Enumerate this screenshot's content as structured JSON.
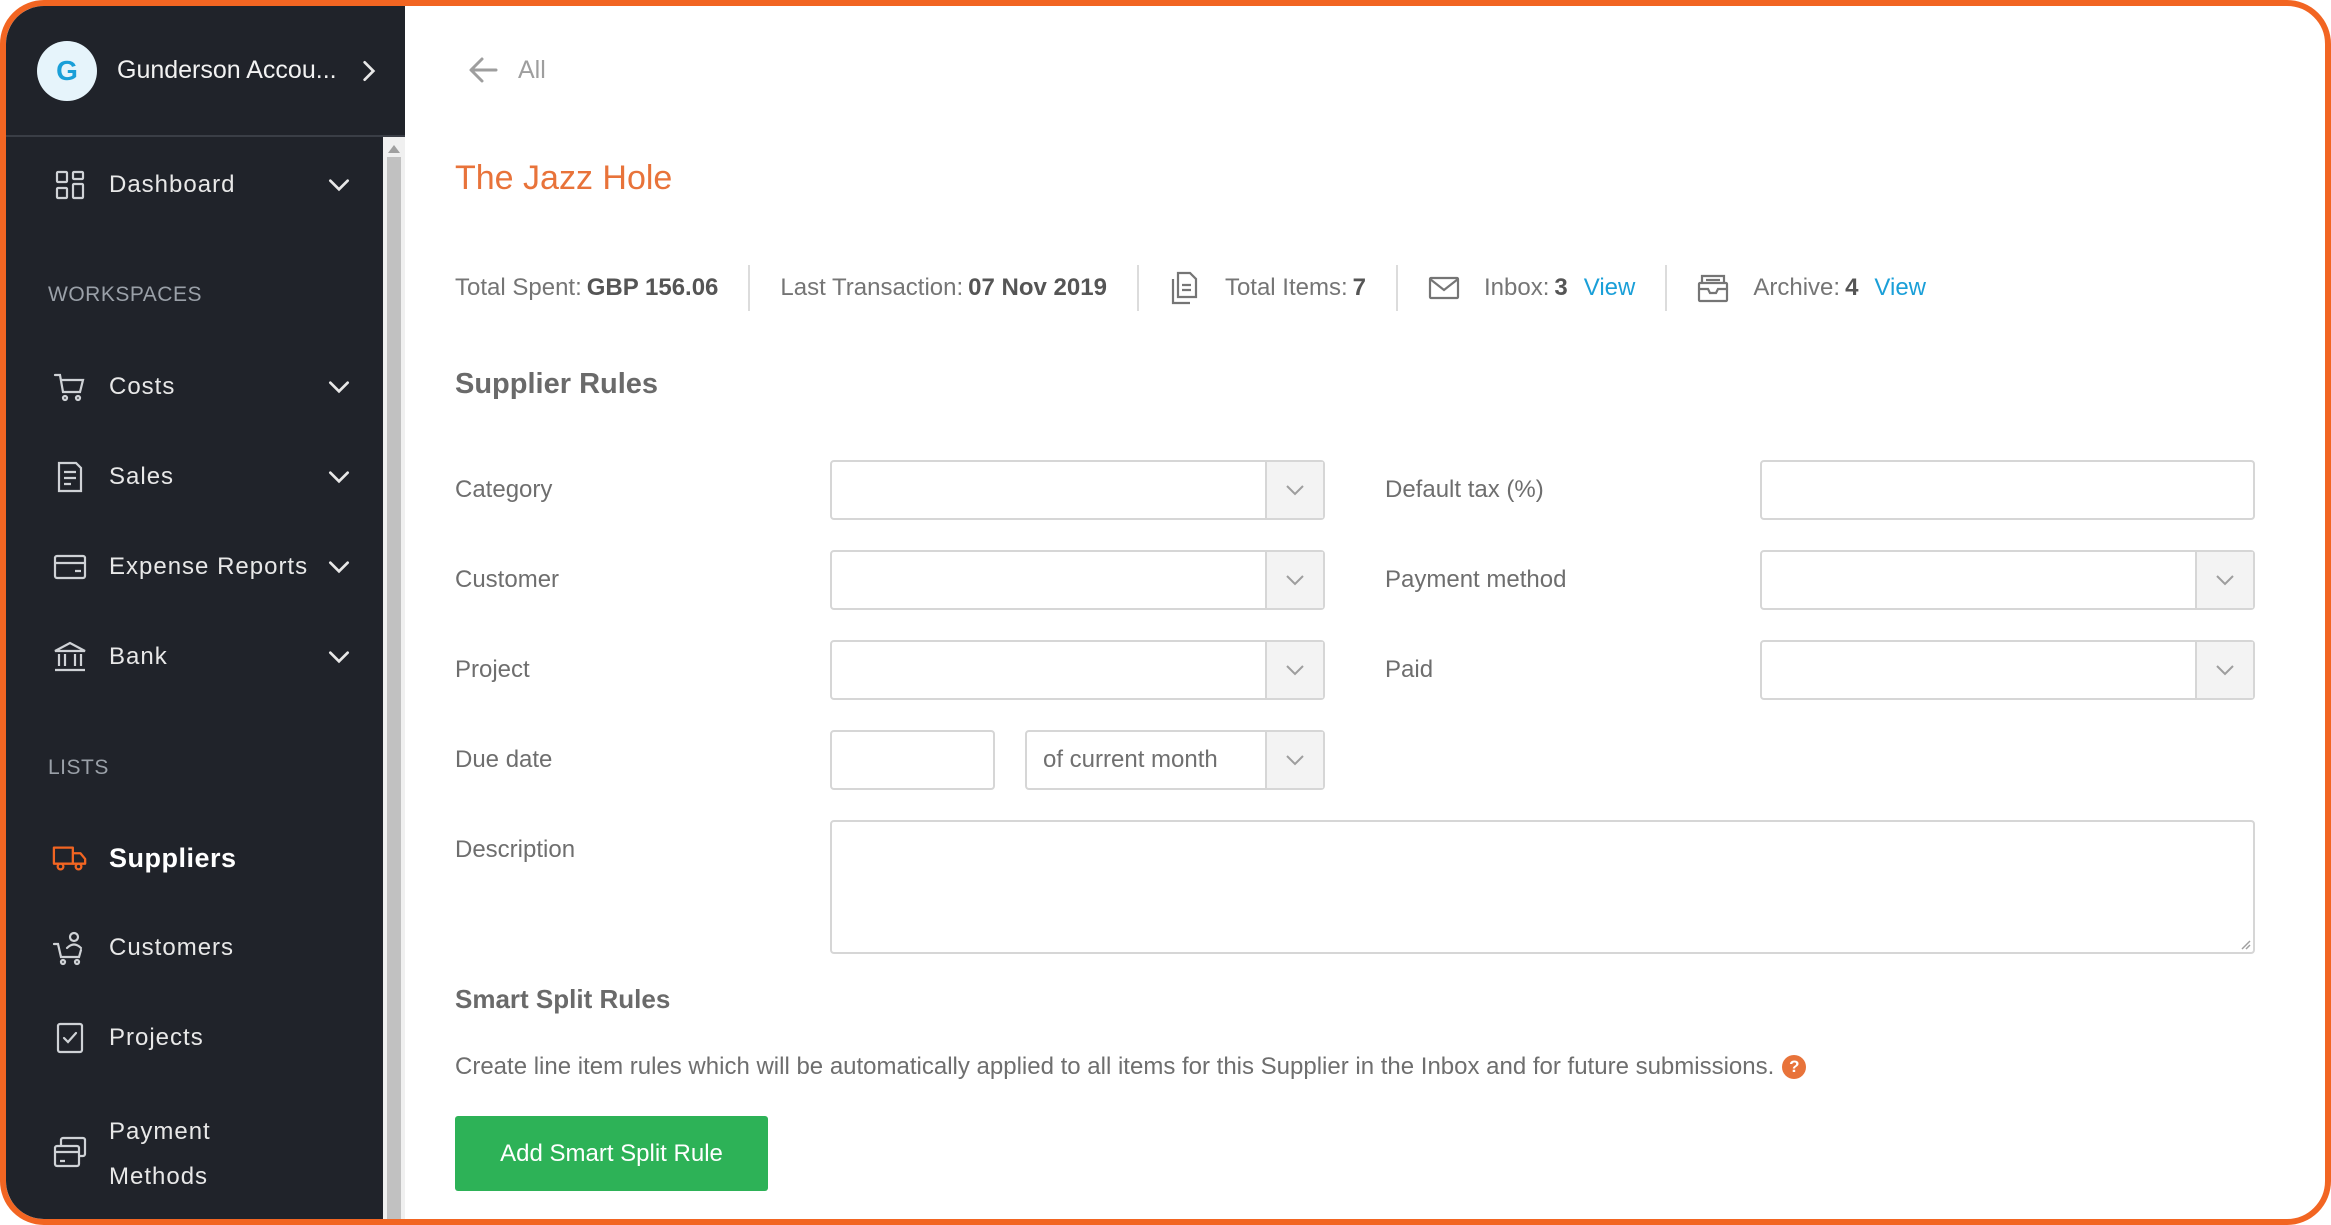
{
  "account": {
    "initial": "G",
    "name": "Gunderson Accou..."
  },
  "sidebar": {
    "dashboard": "Dashboard",
    "workspaces_title": "WORKSPACES",
    "workspaces": [
      "Costs",
      "Sales",
      "Expense Reports",
      "Bank"
    ],
    "lists_title": "LISTS",
    "lists": [
      "Suppliers",
      "Customers",
      "Projects",
      "Payment Methods"
    ],
    "payment_methods_line1": "Payment",
    "payment_methods_line2": "Methods",
    "active": "Suppliers"
  },
  "back": {
    "label": "All"
  },
  "page_title": "The Jazz Hole",
  "stats": {
    "total_spent_label": "Total Spent:",
    "total_spent_value": "GBP 156.06",
    "last_tx_label": "Last Transaction:",
    "last_tx_value": "07 Nov 2019",
    "total_items_label": "Total Items:",
    "total_items_value": "7",
    "inbox_label": "Inbox:",
    "inbox_value": "3",
    "inbox_link": "View",
    "archive_label": "Archive:",
    "archive_value": "4",
    "archive_link": "View"
  },
  "supplier_rules": {
    "title": "Supplier Rules",
    "category_label": "Category",
    "category_value": "",
    "default_tax_label": "Default tax (%)",
    "default_tax_value": "",
    "customer_label": "Customer",
    "customer_value": "",
    "payment_method_label": "Payment method",
    "payment_method_value": "",
    "project_label": "Project",
    "project_value": "",
    "paid_label": "Paid",
    "paid_value": "",
    "due_date_label": "Due date",
    "due_date_value": "",
    "due_date_period": "of current month",
    "description_label": "Description",
    "description_value": ""
  },
  "smart_split": {
    "title": "Smart Split Rules",
    "description": "Create line item rules which will be automatically applied to all items for this Supplier in the Inbox and for future submissions.",
    "help": "?",
    "button": "Add Smart Split Rule"
  },
  "colors": {
    "accent": "#f26522",
    "title": "#e8733a",
    "link": "#1a9fd8",
    "button": "#2db257",
    "sidebar": "#20232a"
  }
}
